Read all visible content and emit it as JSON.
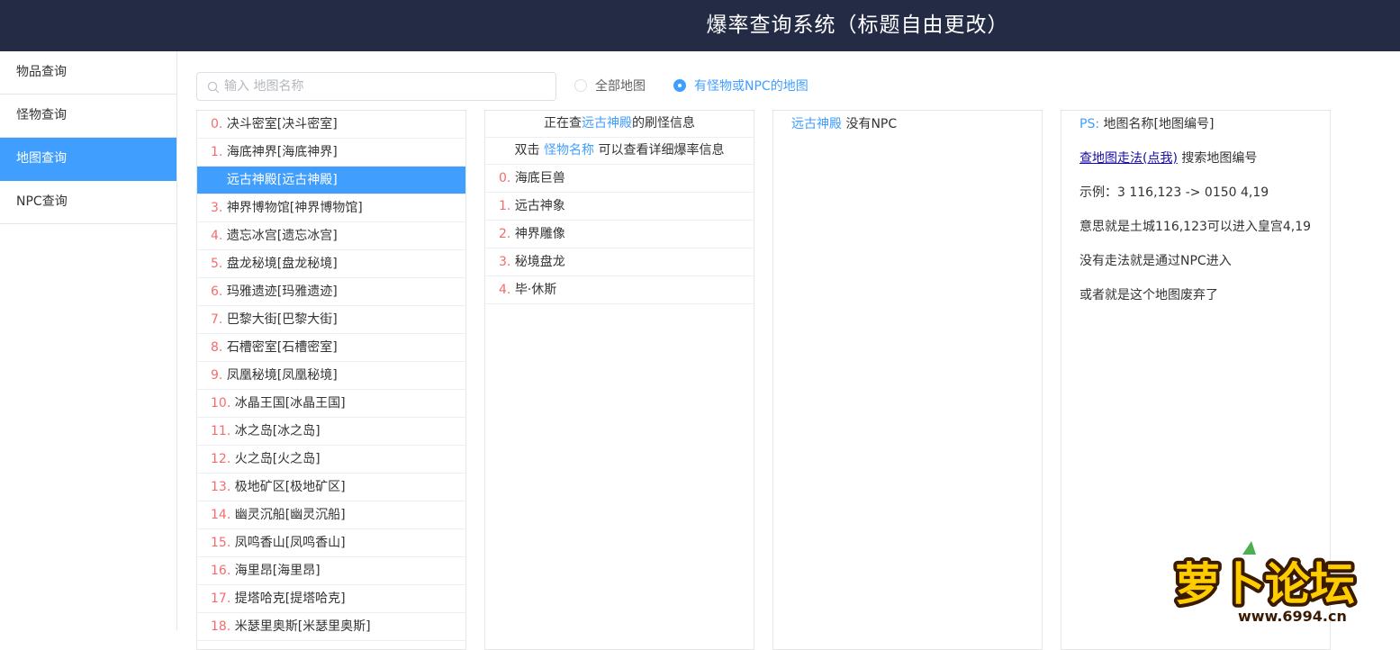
{
  "header": {
    "title": "爆率查询系统（标题自由更改）"
  },
  "sidebar": {
    "items": [
      {
        "label": "物品查询"
      },
      {
        "label": "怪物查询"
      },
      {
        "label": "地图查询"
      },
      {
        "label": "NPC查询"
      }
    ],
    "active_index": 2
  },
  "search": {
    "placeholder": "输入 地图名称",
    "value": ""
  },
  "filters": {
    "all_maps": "全部地图",
    "with_monsters": "有怪物或NPC的地图",
    "selected": "with_monsters"
  },
  "map_list": {
    "selected_index": 2,
    "items": [
      {
        "idx": "0.",
        "name": "决斗密室[决斗密室]"
      },
      {
        "idx": "1.",
        "name": "海底神界[海底神界]"
      },
      {
        "idx": "2.",
        "name": "远古神殿[远古神殿]"
      },
      {
        "idx": "3.",
        "name": "神界博物馆[神界博物馆]"
      },
      {
        "idx": "4.",
        "name": "遗忘冰宫[遗忘冰宫]"
      },
      {
        "idx": "5.",
        "name": "盘龙秘境[盘龙秘境]"
      },
      {
        "idx": "6.",
        "name": "玛雅遗迹[玛雅遗迹]"
      },
      {
        "idx": "7.",
        "name": "巴黎大街[巴黎大街]"
      },
      {
        "idx": "8.",
        "name": "石槽密室[石槽密室]"
      },
      {
        "idx": "9.",
        "name": "凤凰秘境[凤凰秘境]"
      },
      {
        "idx": "10.",
        "name": "冰晶王国[冰晶王国]"
      },
      {
        "idx": "11.",
        "name": "冰之岛[冰之岛]"
      },
      {
        "idx": "12.",
        "name": "火之岛[火之岛]"
      },
      {
        "idx": "13.",
        "name": "极地矿区[极地矿区]"
      },
      {
        "idx": "14.",
        "name": "幽灵沉船[幽灵沉船]"
      },
      {
        "idx": "15.",
        "name": "凤鸣香山[凤鸣香山]"
      },
      {
        "idx": "16.",
        "name": "海里昂[海里昂]"
      },
      {
        "idx": "17.",
        "name": "提塔哈克[提塔哈克]"
      },
      {
        "idx": "18.",
        "name": "米瑟里奥斯[米瑟里奥斯]"
      }
    ]
  },
  "monster_panel": {
    "header_prefix": "正在查",
    "map_name": "远古神殿",
    "header_suffix": "的刷怪信息",
    "hint_prefix": "双击",
    "hint_link": "怪物名称",
    "hint_suffix": "可以查看详细爆率信息",
    "items": [
      {
        "idx": "0.",
        "name": "海底巨兽"
      },
      {
        "idx": "1.",
        "name": "远古神象"
      },
      {
        "idx": "2.",
        "name": "神界雕像"
      },
      {
        "idx": "3.",
        "name": "秘境盘龙"
      },
      {
        "idx": "4.",
        "name": "毕·休斯"
      }
    ]
  },
  "npc_panel": {
    "map_name": "远古神殿",
    "text": "没有NPC"
  },
  "info_panel": {
    "ps_label": "PS:",
    "ps_text": "地图名称[地图编号]",
    "link_text": "查地图走法(点我)",
    "link_suffix": "搜索地图编号",
    "example": "示例：3 116,123 -> 0150 4,19",
    "meaning": "意思就是土城116,123可以进入皇宫4,19",
    "npc_note": "没有走法就是通过NPC进入",
    "abandoned": "或者就是这个地图废弃了"
  },
  "watermark": {
    "text": "萝卜论坛",
    "url": "www.6994.cn"
  },
  "colors": {
    "header_bg": "#232b45",
    "accent": "#409eff",
    "index_red": "#f56c6c"
  }
}
